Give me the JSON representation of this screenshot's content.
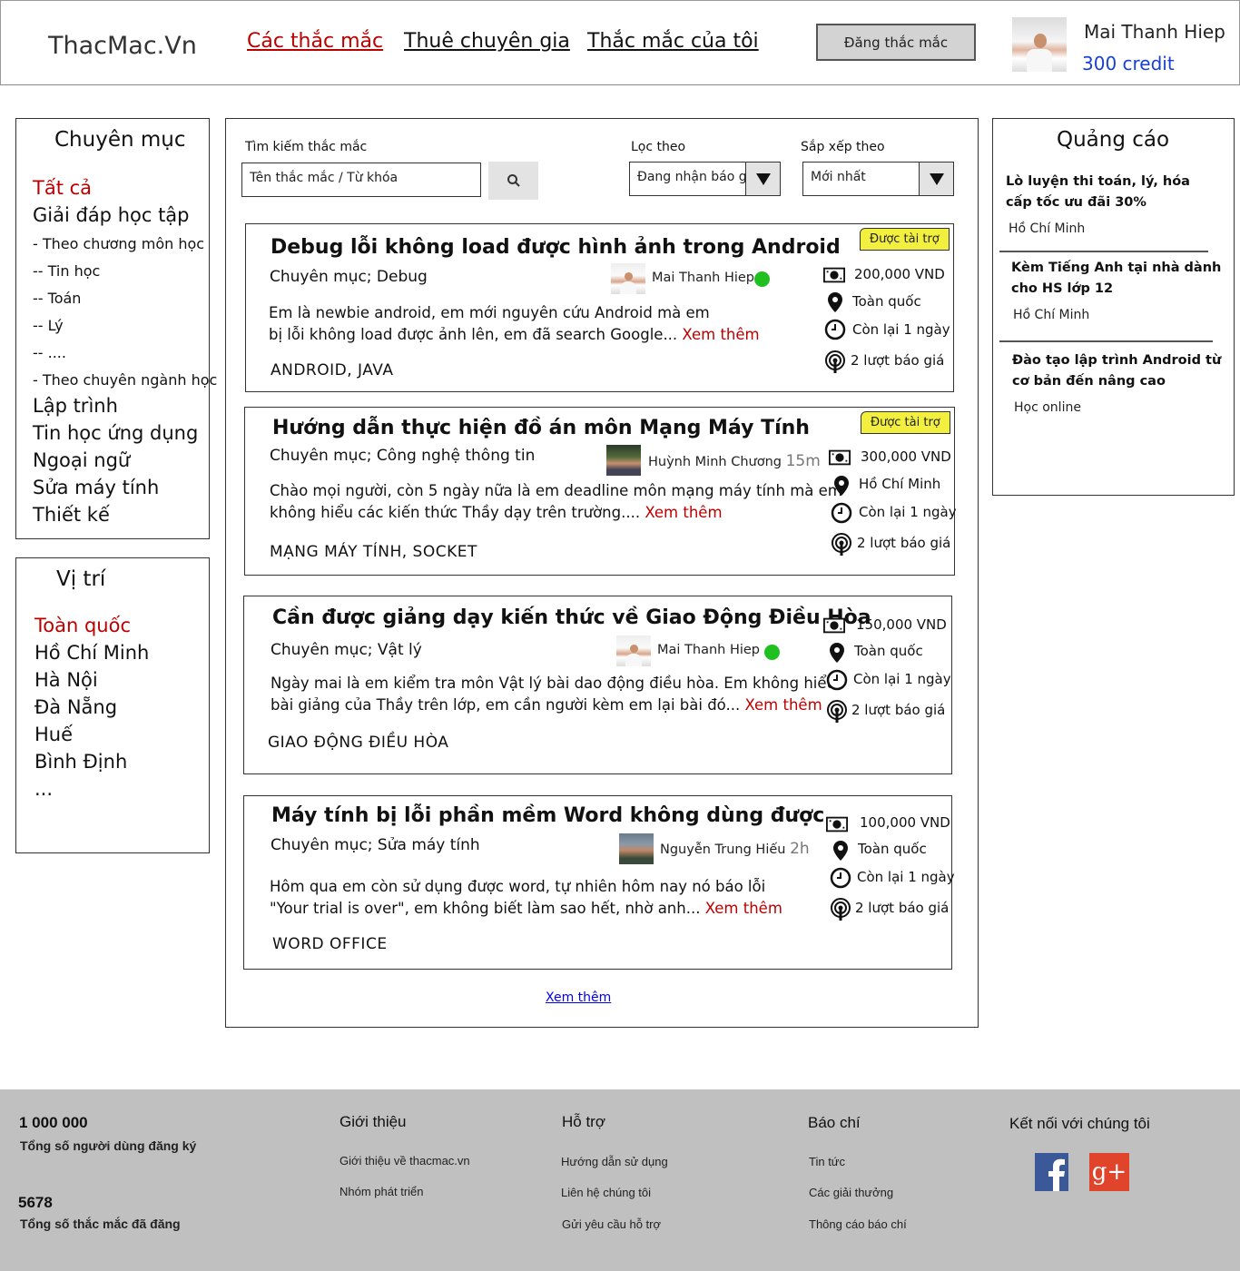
{
  "header": {
    "logo": "ThacMac.Vn",
    "nav": [
      "Các thắc mắc",
      "Thuê chuyên gia",
      "Thắc mắc của tôi"
    ],
    "post_button": "Đăng thắc mắc",
    "user": {
      "name": "Mai Thanh Hiep",
      "credit": "300 credit"
    }
  },
  "categories": {
    "title": "Chuyên mục",
    "items": [
      "Tất cả",
      "Giải đáp học tập",
      "- Theo chương môn học",
      "-- Tin học",
      "-- Toán",
      "-- Lý",
      "-- ....",
      "- Theo chuyên ngành học",
      "Lập trình",
      "Tin học ứng dụng",
      "Ngoại ngữ",
      "Sửa máy tính",
      "Thiết kế"
    ]
  },
  "locations": {
    "title": "Vị trí",
    "items": [
      "Toàn quốc",
      "Hồ Chí Minh",
      "Hà Nội",
      "Đà Nẵng",
      "Huế",
      "Bình Định",
      "..."
    ]
  },
  "search": {
    "label": "Tìm kiếm thắc mắc",
    "placeholder": "Tên thắc mắc / Từ khóa",
    "filter_label": "Lọc theo",
    "filter_value": "Đang nhận báo giá",
    "sort_label": "Sắp xếp theo",
    "sort_value": "Mới nhất"
  },
  "questions": [
    {
      "title": "Debug lỗi không load được hình ảnh trong Android",
      "category": "Chuyên mục; Debug",
      "author": "Mai Thanh Hiep",
      "time": "",
      "online": true,
      "sponsored": "Được tài trợ",
      "desc1": "Em là newbie android, em mới nguyên cứu Android mà em",
      "desc2": "bị lỗi không load được ảnh lên, em đã search Google... ",
      "more": "Xem thêm",
      "tags": "ANDROID, JAVA",
      "price": "200,000 VND",
      "location": "Toàn quốc",
      "remaining": "Còn lại 1 ngày",
      "bids": "2 lượt báo giá"
    },
    {
      "title": "Hướng dẫn thực hiện đồ án môn Mạng Máy Tính",
      "category": "Chuyên mục; Công nghệ thông tin",
      "author": "Huỳnh Minh Chương",
      "time": "15m",
      "online": false,
      "sponsored": "Được tài trợ",
      "desc1": "Chào mọi người, còn 5 ngày nữa là em deadline môn mạng máy tính mà em",
      "desc2": "không hiểu các kiến thức Thầy dạy trên trường.... ",
      "more": "Xem thêm",
      "tags": "MẠNG MÁY TÍNH, SOCKET",
      "price": "300,000 VND",
      "location": "Hồ Chí Minh",
      "remaining": "Còn lại 1 ngày",
      "bids": "2 lượt báo giá"
    },
    {
      "title": "Cần được giảng dạy kiến thức về Giao Động Điều Hòa",
      "category": "Chuyên mục; Vật lý",
      "author": "Mai Thanh Hiep",
      "time": "",
      "online": true,
      "sponsored": "",
      "desc1": "Ngày mai là em kiểm tra môn Vật lý bài dao động điều hòa. Em không hiểu",
      "desc2": "bài giảng của Thầy trên lớp, em cần người kèm em lại bài đó... ",
      "more": "Xem thêm",
      "tags": "GIAO ĐỘNG ĐIỀU HÒA",
      "price": "150,000 VND",
      "location": "Toàn quốc",
      "remaining": "Còn lại 1 ngày",
      "bids": "2 lượt báo giá"
    },
    {
      "title": "Máy tính bị lỗi phần mềm Word không dùng được",
      "category": "Chuyên mục; Sửa máy tính",
      "author": "Nguyễn Trung Hiếu",
      "time": "2h",
      "online": false,
      "sponsored": "",
      "desc1": "Hôm qua em còn sử dụng được word, tự nhiên hôm nay nó báo lỗi",
      "desc2": "\"Your trial is over\", em không biết làm sao hết, nhờ anh... ",
      "more": "Xem thêm",
      "tags": "WORD OFFICE",
      "price": "100,000 VND",
      "location": "Toàn quốc",
      "remaining": "Còn lại 1 ngày",
      "bids": "2 lượt báo giá"
    }
  ],
  "load_more": "Xem thêm",
  "ads": {
    "title": "Quảng cáo",
    "items": [
      {
        "line1": "Lò luyện thi toán, lý, hóa",
        "line2": "cấp tốc ưu đãi 30%",
        "location": "Hồ Chí Minh"
      },
      {
        "line1": "Kèm Tiếng Anh tại nhà dành",
        "line2": "cho HS lớp 12",
        "location": "Hồ Chí Minh"
      },
      {
        "line1": "Đào tạo lập trình Android từ",
        "line2": "cơ bản đến nâng cao",
        "location": "Học online"
      }
    ]
  },
  "footer": {
    "users_count": "1 000 000",
    "users_label": "Tổng số người dùng đăng ký",
    "questions_count": "5678",
    "questions_label": "Tổng số thắc mắc đã đăng",
    "intro": {
      "title": "Giới thiệu",
      "links": [
        "Giới thiệu về thacmac.vn",
        "Nhóm phát triển"
      ]
    },
    "support": {
      "title": "Hỗ trợ",
      "links": [
        "Hướng dẫn sử dụng",
        "Liên hệ chúng tôi",
        "Gửi yêu cầu hỗ trợ"
      ]
    },
    "press": {
      "title": "Báo chí",
      "links": [
        "Tin tức",
        "Các giải thưởng",
        "Thông cáo báo chí"
      ]
    },
    "connect": {
      "title": "Kết nối với chúng tôi",
      "icons": [
        "facebook-icon",
        "google-plus-icon"
      ]
    }
  },
  "colors": {
    "accent_red": "#b00000",
    "credit_blue": "#1a3fd3",
    "online_green": "#20c020",
    "sponsored_yellow": "#f3ef3e",
    "footer_bg": "#c0c0c0"
  }
}
